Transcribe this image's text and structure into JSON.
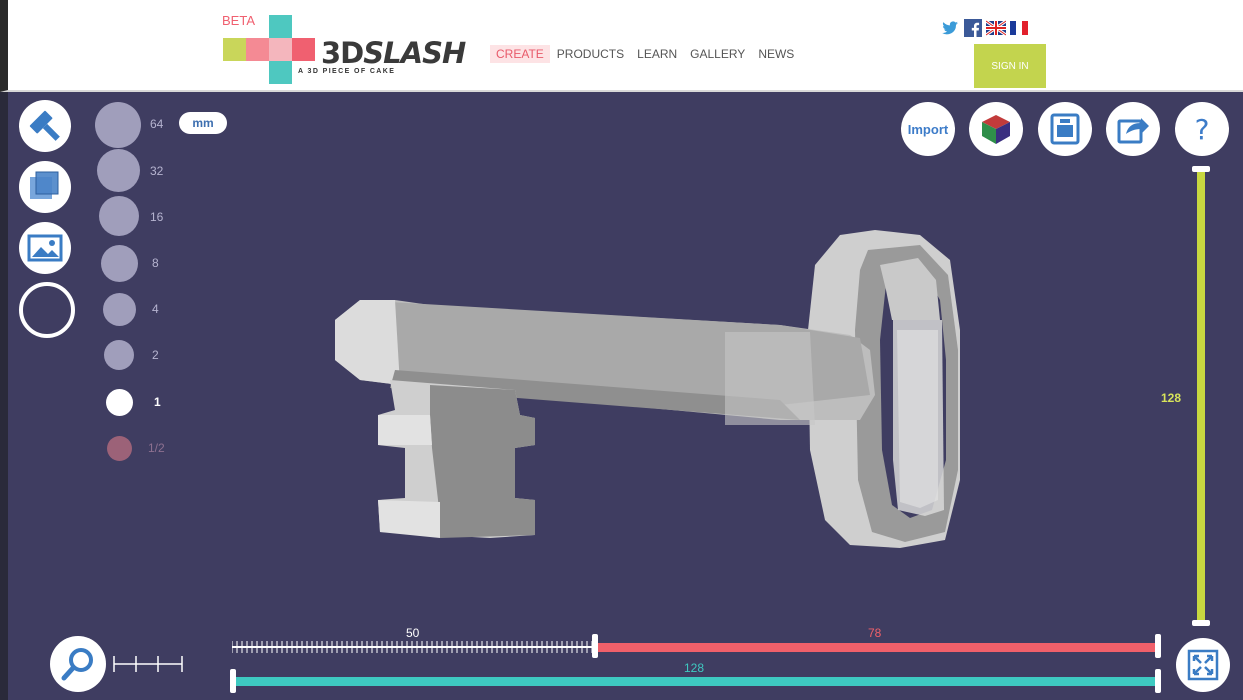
{
  "header": {
    "beta": "BETA",
    "brand_bold": "3D",
    "brand_italic": "SLASH",
    "tagline": "A 3D PIECE OF CAKE",
    "nav": [
      "CREATE",
      "PRODUCTS",
      "LEARN",
      "GALLERY",
      "NEWS"
    ],
    "active_nav": "CREATE",
    "social_icons": [
      "twitter-icon",
      "facebook-icon",
      "uk-flag-icon",
      "france-flag-icon"
    ],
    "signin_label": "SIGN IN"
  },
  "tools": [
    "hammer-icon",
    "cube-icon",
    "image-icon",
    "ring-icon"
  ],
  "sizes": {
    "labels": [
      "64",
      "32",
      "16",
      "8",
      "4",
      "2",
      "1",
      "1/2"
    ],
    "selected": "1",
    "unit": "mm"
  },
  "top_actions": {
    "import_label": "Import",
    "icons": [
      "color-cube-icon",
      "print-icon",
      "share-icon",
      "help-icon"
    ],
    "help_label": "?"
  },
  "sliders": {
    "vertical_value": "128",
    "horizontal_left_value": "50",
    "horizontal_right_value": "78",
    "horizontal_bottom_value": "128"
  },
  "colors": {
    "background": "#3f3d61",
    "accent_pink": "#f06070",
    "accent_green": "#c8d840",
    "accent_teal": "#3ec9c1",
    "accent_red_bar": "#f0606a"
  },
  "model": "key"
}
